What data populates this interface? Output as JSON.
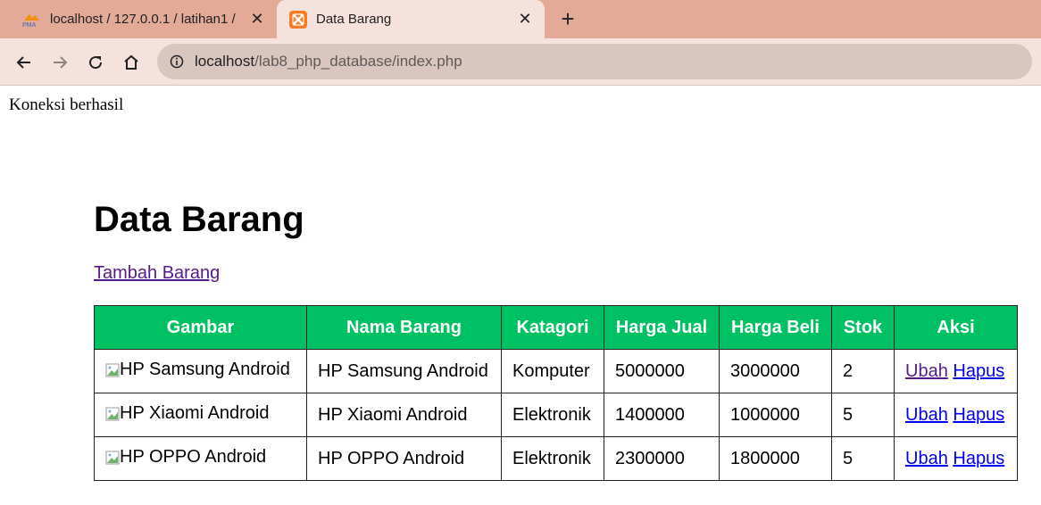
{
  "browser": {
    "tabs": [
      {
        "title": "localhost / 127.0.0.1 / latihan1 / ",
        "favicon": "phpmyadmin-icon",
        "active": false
      },
      {
        "title": "Data Barang",
        "favicon": "xampp-icon",
        "active": true
      }
    ],
    "url_host": "localhost",
    "url_path": "/lab8_php_database/index.php"
  },
  "page": {
    "status": "Koneksi berhasil",
    "title": "Data Barang",
    "add_link": "Tambah Barang",
    "table": {
      "headers": [
        "Gambar",
        "Nama Barang",
        "Katagori",
        "Harga Jual",
        "Harga Beli",
        "Stok",
        "Aksi"
      ],
      "rows": [
        {
          "gambar_alt": "HP Samsung Android",
          "nama": "HP Samsung Android",
          "kategori": "Komputer",
          "harga_jual": "5000000",
          "harga_beli": "3000000",
          "stok": "2",
          "ubah": "Ubah",
          "hapus": "Hapus"
        },
        {
          "gambar_alt": "HP Xiaomi Android",
          "nama": "HP Xiaomi Android",
          "kategori": "Elektronik",
          "harga_jual": "1400000",
          "harga_beli": "1000000",
          "stok": "5",
          "ubah": "Ubah",
          "hapus": "Hapus"
        },
        {
          "gambar_alt": "HP OPPO Android",
          "nama": "HP OPPO Android",
          "kategori": "Elektronik",
          "harga_jual": "2300000",
          "harga_beli": "1800000",
          "stok": "5",
          "ubah": "Ubah",
          "hapus": "Hapus"
        }
      ]
    }
  },
  "colors": {
    "tabstrip": "#e3aa97",
    "toolbar": "#f6e2dc",
    "table_header": "#00c064",
    "link": "#0000ee",
    "visited_link": "#551a8b"
  }
}
